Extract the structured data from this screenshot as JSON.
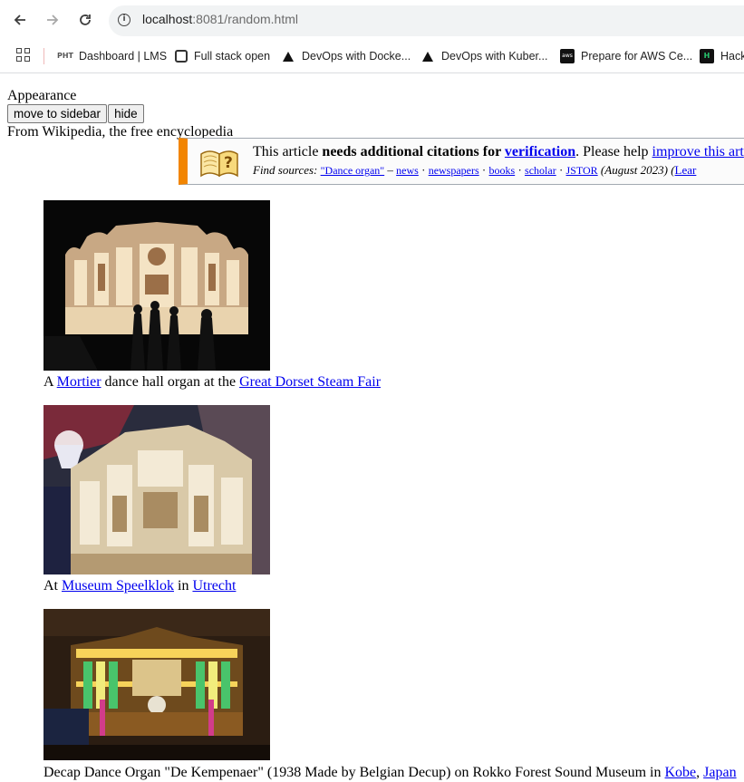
{
  "browser": {
    "url_host": "localhost",
    "url_rest": ":8081/random.html",
    "bookmarks": [
      {
        "icon": "pht-logo-icon",
        "label": "Dashboard | LMS"
      },
      {
        "icon": "square-icon",
        "label": "Full stack open"
      },
      {
        "icon": "triangle-logo-icon",
        "label": "DevOps with Docke..."
      },
      {
        "icon": "triangle-logo-icon",
        "label": "DevOps with Kuber..."
      },
      {
        "icon": "aws-logo-icon",
        "label": "Prepare for AWS Ce..."
      },
      {
        "icon": "hackerrank-logo-icon",
        "label": "Hack"
      }
    ]
  },
  "page": {
    "appearance": "Appearance",
    "move_button": "move to sidebar",
    "hide_button": "hide",
    "tagline": "From Wikipedia, the free encyclopedia",
    "notice": {
      "this_article": "This article ",
      "needs": "needs additional citations for ",
      "verification": "verification",
      "please_help": ". Please help ",
      "improve": "improve this art",
      "find_sources": "Find sources:",
      "query": "\"Dance organ\"",
      "dash": " – ",
      "news": "news",
      "newspapers": "newspapers",
      "books": "books",
      "scholar": "scholar",
      "jstor": "JSTOR",
      "date": "(August 2023)",
      "learn_open": "(",
      "learn": "Lear"
    },
    "figures": [
      {
        "caption_parts": [
          "A ",
          "Mortier",
          " dance hall organ at the ",
          "Great Dorset Steam Fair",
          ""
        ]
      },
      {
        "caption_parts": [
          "At ",
          "Museum Speelklok",
          " in ",
          "Utrecht",
          ""
        ]
      },
      {
        "caption_parts": [
          "Decap Dance Organ \"De Kempenaer\" (1938 Made by Belgian Decup) on Rokko Forest Sound Museum in ",
          "Kobe",
          ", ",
          "Japan"
        ]
      }
    ]
  },
  "colors": {
    "link": "#0000ee",
    "notice_accent": "#f28500",
    "omnibox_bg": "#f1f3f4"
  }
}
